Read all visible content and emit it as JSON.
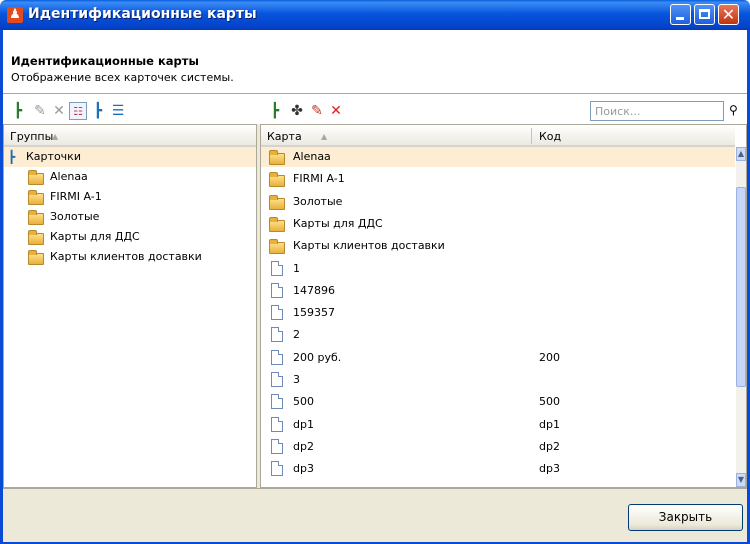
{
  "window": {
    "title": "Идентификационные карты"
  },
  "header": {
    "title": "Идентификационные карты",
    "subtitle": "Отображение всех карточек системы."
  },
  "search": {
    "placeholder": "Поиск..."
  },
  "groups": {
    "column": "Группы",
    "root": "Карточки",
    "items": [
      "Alenaa",
      "FIRMI A-1",
      "Золотые",
      "Карты для ДДС",
      "Карты клиентов доставки"
    ]
  },
  "cards": {
    "columns": {
      "card": "Карта",
      "code": "Код"
    },
    "rows": [
      {
        "type": "folder",
        "name": "Alenaa",
        "code": ""
      },
      {
        "type": "folder",
        "name": "FIRMI A-1",
        "code": ""
      },
      {
        "type": "folder",
        "name": "Золотые",
        "code": ""
      },
      {
        "type": "folder",
        "name": "Карты для ДДС",
        "code": ""
      },
      {
        "type": "folder",
        "name": "Карты клиентов доставки",
        "code": ""
      },
      {
        "type": "doc",
        "name": "1",
        "code": ""
      },
      {
        "type": "doc",
        "name": "147896",
        "code": ""
      },
      {
        "type": "doc",
        "name": "159357",
        "code": ""
      },
      {
        "type": "doc",
        "name": "2",
        "code": ""
      },
      {
        "type": "doc",
        "name": "200 руб.",
        "code": "200"
      },
      {
        "type": "doc",
        "name": "3",
        "code": ""
      },
      {
        "type": "doc",
        "name": "500",
        "code": "500"
      },
      {
        "type": "doc",
        "name": "dp1",
        "code": "dp1"
      },
      {
        "type": "doc",
        "name": "dp2",
        "code": "dp2"
      },
      {
        "type": "doc",
        "name": "dp3",
        "code": "dp3"
      }
    ]
  },
  "footer": {
    "close_label": "Закрыть"
  },
  "icons": {
    "left_toolbar": [
      "add-group-icon",
      "edit-icon",
      "delete-icon",
      "view-list-icon",
      "tree-view-icon",
      "list-view-icon"
    ],
    "right_toolbar": [
      "add-card-icon",
      "add-item-icon",
      "edit-icon",
      "delete-icon"
    ],
    "search": "binoculars-icon"
  }
}
